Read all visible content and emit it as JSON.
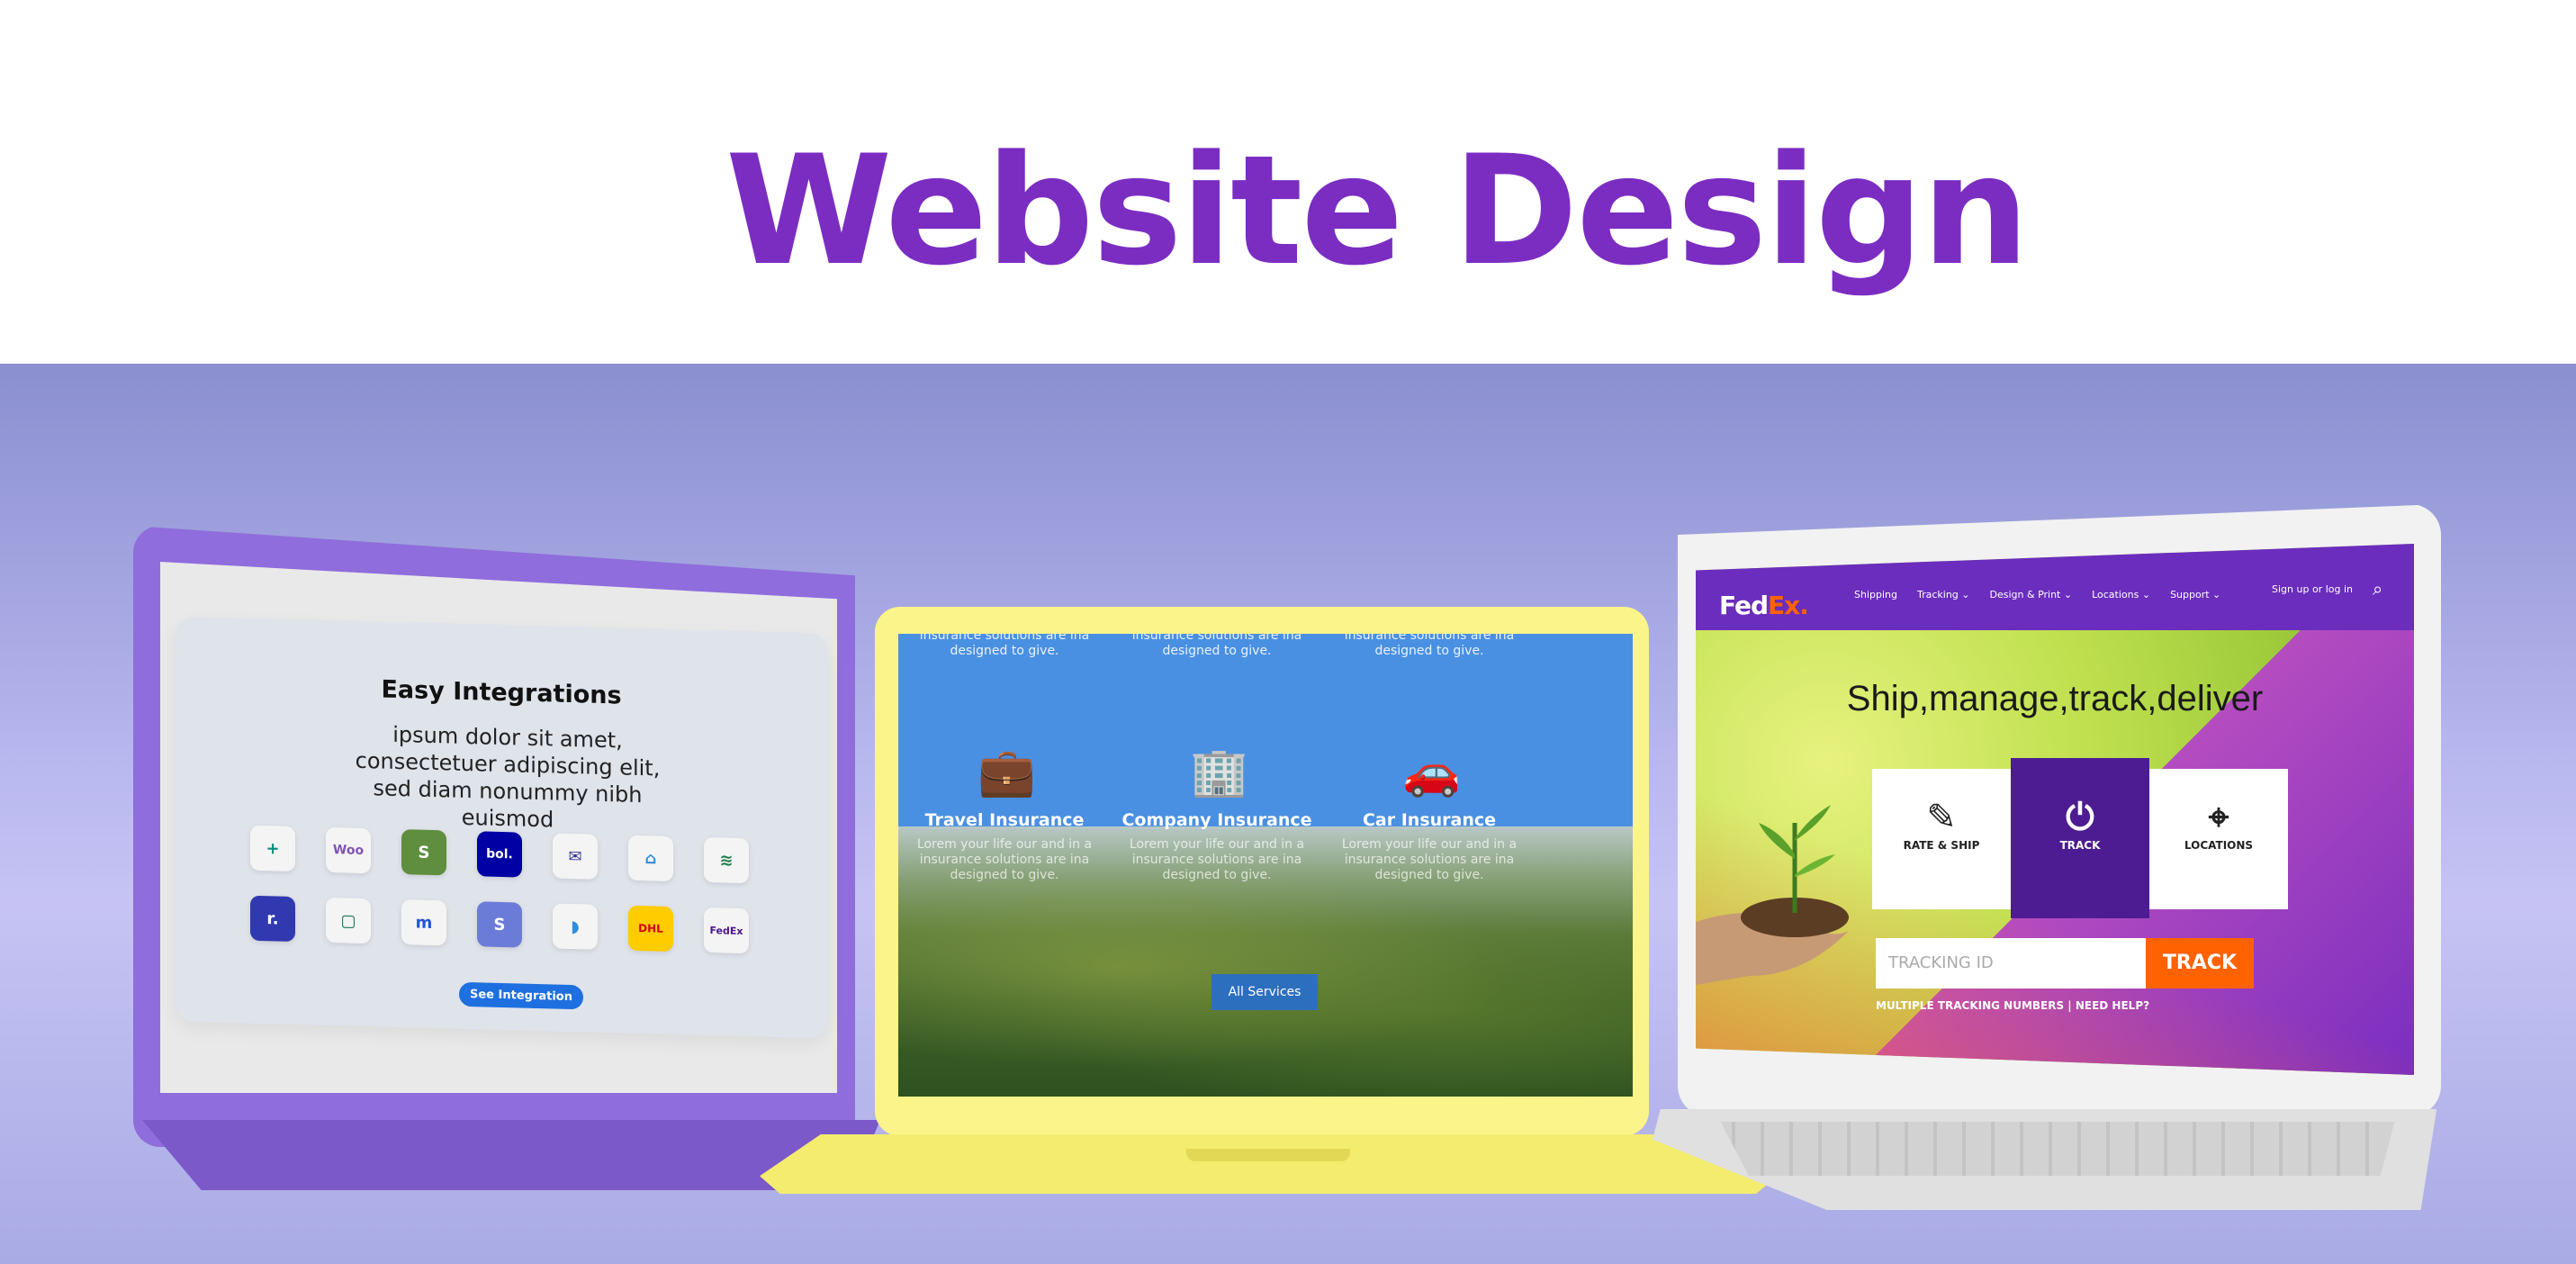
{
  "headline": "Website Design",
  "colors": {
    "accent": "#7b2dc2",
    "fedex_purple": "#6b2dbd",
    "fedex_orange": "#ff6200",
    "insurance_blue": "#4a90e2"
  },
  "integrations": {
    "title": "Easy Integrations",
    "text": "ipsum dolor sit amet, consectetuer adipiscing elit, sed diam nonummy nibh euismod",
    "logos": [
      "+",
      "Woo",
      "S",
      "bol.",
      "✉",
      "⌂",
      "≋",
      "r.",
      "▢",
      "m",
      "S",
      "◗",
      "DHL",
      "FedEx"
    ],
    "button": "See Integration"
  },
  "insurance": {
    "top_text": "insurance solutions are ina designed to give.",
    "columns": [
      {
        "icon": "briefcase-icon",
        "glyph": "💼",
        "title": "Travel Insurance"
      },
      {
        "icon": "building-icon",
        "glyph": "🏢",
        "title": "Company Insurance"
      },
      {
        "icon": "car-icon",
        "glyph": "🚗",
        "title": "Car Insurance"
      }
    ],
    "bottom_text": "Lorem your life our and in a insurance solutions are ina designed to give.",
    "button": "All Services"
  },
  "fedex": {
    "logo_fed": "Fed",
    "logo_ex": "Ex",
    "logo_dot": ".",
    "nav": [
      "Shipping",
      "Tracking ⌄",
      "Design & Print ⌄",
      "Locations ⌄",
      "Support ⌄"
    ],
    "sign_in": "Sign up or log in",
    "headline": "Ship,manage,track,deliver",
    "tiles": [
      "RATE & SHIP",
      "TRACK",
      "LOCATIONS"
    ],
    "input_placeholder": "TRACKING ID",
    "track_button": "TRACK",
    "help": "MULTIPLE TRACKING NUMBERS | NEED HELP?"
  }
}
